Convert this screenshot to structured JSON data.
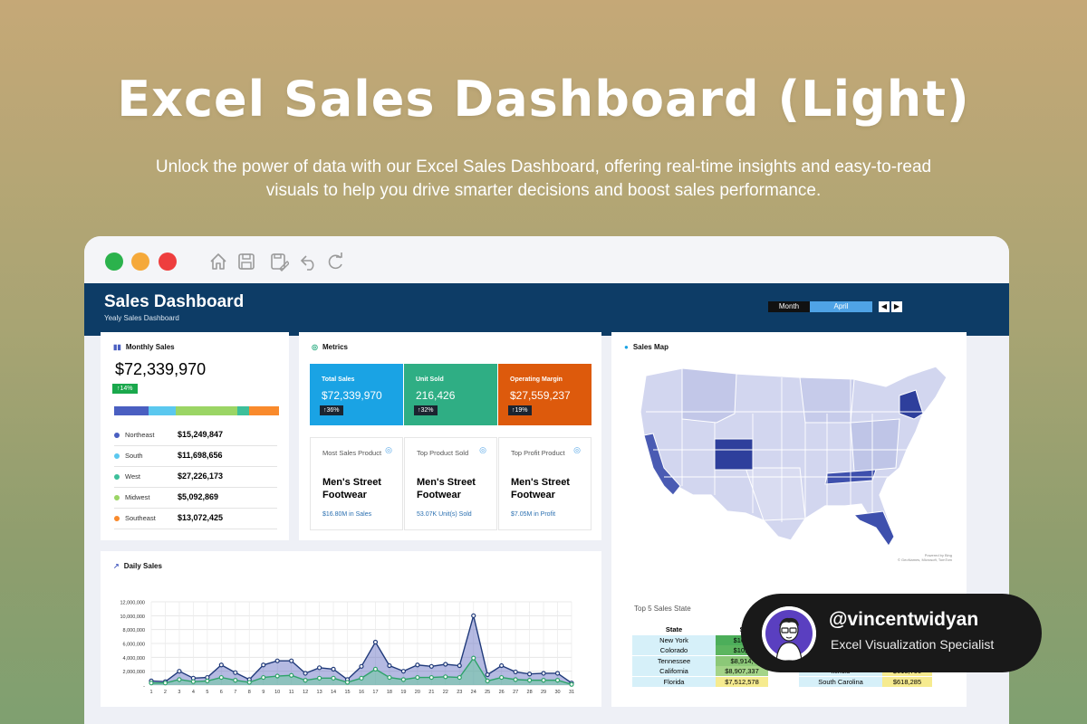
{
  "hero": {
    "title": "Excel Sales Dashboard (Light)",
    "subtitle": "Unlock the power of data with our Excel Sales Dashboard, offering real-time insights and easy-to-read visuals to help you drive smarter decisions and boost sales performance."
  },
  "window": {
    "traffic_lights": [
      {
        "name": "green",
        "color": "#2bb24c"
      },
      {
        "name": "yellow",
        "color": "#f5a93a"
      },
      {
        "name": "red",
        "color": "#ee3e3e"
      }
    ],
    "toolbar_icons": [
      "home-icon",
      "save-icon",
      "save-as-icon",
      "undo-icon",
      "redo-icon"
    ]
  },
  "header": {
    "title": "Sales Dashboard",
    "subtitle": "Yealy Sales Dashboard",
    "period_label": "Month",
    "period_value": "April",
    "prev": "◀",
    "next": "▶",
    "color": "#0d3c66"
  },
  "monthly_sales": {
    "title": "Monthly Sales",
    "total": "$72,339,970",
    "change": "↑14%",
    "regions": [
      {
        "name": "Northeast",
        "value": "$15,249,847",
        "color": "#4a5fc1",
        "share": 0.211
      },
      {
        "name": "South",
        "value": "$11,698,656",
        "color": "#5bc8ef",
        "share": 0.162
      },
      {
        "name": "West",
        "value": "$27,226,173",
        "color": "#9bd565",
        "share": 0.376
      },
      {
        "name": "Midwest",
        "value": "$5,092,869",
        "color": "#3dbf9a",
        "share": 0.07
      },
      {
        "name": "Southeast",
        "value": "$13,072,425",
        "color": "#f98a2c",
        "share": 0.181
      }
    ],
    "bullet_colors": [
      "#4a5fc1",
      "#5bc8ef",
      "#3dbf9a",
      "#9bd565",
      "#f98a2c"
    ]
  },
  "metrics": {
    "title": "Metrics",
    "kpis": [
      {
        "label": "Total Sales",
        "value": "$72,339,970",
        "change": "↑36%",
        "color": "#1aa3e4"
      },
      {
        "label": "Unit Sold",
        "value": "216,426",
        "change": "↑32%",
        "color": "#2fae84"
      },
      {
        "label": "Operating Margin",
        "value": "$27,559,237",
        "change": "↑19%",
        "color": "#dd5a0c"
      }
    ],
    "products": [
      {
        "label": "Most Sales Product",
        "name": "Men's Street Footwear",
        "foot": "$16.80M in Sales"
      },
      {
        "label": "Top Product Sold",
        "name": "Men's Street Footwear",
        "foot": "53.07K Unit(s) Sold"
      },
      {
        "label": "Top Profit Product",
        "name": "Men's Street Footwear",
        "foot": "$7.05M in Profit"
      }
    ]
  },
  "sales_map": {
    "title": "Sales Map",
    "credit_1": "Powered by Bing",
    "credit_2": "© GeoNames, Microsoft, TomTom",
    "top5_title": "Top 5 Sales State",
    "table_header": "State",
    "table_header_2": "S",
    "left_rows": [
      {
        "state": "New York",
        "value": "$10,1",
        "color": "#4cae5a"
      },
      {
        "state": "Colorado",
        "value": "$10,0",
        "color": "#5cb55f"
      },
      {
        "state": "Tennessee",
        "value": "$8,914,",
        "color": "#8cc878"
      },
      {
        "state": "California",
        "value": "$8,907,337",
        "color": "#a4d488"
      },
      {
        "state": "Florida",
        "value": "$7,512,578",
        "color": "#f6eb8f"
      }
    ],
    "right_rows": [
      {
        "state": "",
        "value": "",
        "color": "#d6f0f9"
      },
      {
        "state": "",
        "value": "",
        "color": "#d6f0f9"
      },
      {
        "state": "",
        "value": "",
        "color": "#d6f0f9"
      },
      {
        "state": "Illinois",
        "value": "$618,700",
        "color": "#f6eb8f"
      },
      {
        "state": "South Carolina",
        "value": "$618,285",
        "color": "#f6eb8f"
      }
    ]
  },
  "daily_sales": {
    "title": "Daily Sales"
  },
  "chart_data": {
    "type": "area",
    "title": "Daily Sales",
    "x": [
      1,
      2,
      3,
      4,
      5,
      6,
      7,
      8,
      9,
      10,
      11,
      12,
      13,
      14,
      15,
      16,
      17,
      18,
      19,
      20,
      21,
      22,
      23,
      24,
      25,
      26,
      27,
      28,
      29,
      30,
      31
    ],
    "y_ticks": [
      "-",
      "2,000,000",
      "4,000,000",
      "6,000,000",
      "8,000,000",
      "10,000,000",
      "12,000,000"
    ],
    "ylim": [
      0,
      12000000
    ],
    "grid": true,
    "series": [
      {
        "values": [
          600000,
          500000,
          2000000,
          1000000,
          1100000,
          2900000,
          1800000,
          800000,
          2900000,
          3500000,
          3500000,
          1700000,
          2500000,
          2300000,
          800000,
          2700000,
          6200000,
          2800000,
          2000000,
          2900000,
          2700000,
          3000000,
          2800000,
          10000000,
          1500000,
          2800000,
          1900000,
          1600000,
          1700000,
          1700000,
          300000
        ],
        "color": "#203a7a"
      },
      {
        "values": [
          300000,
          300000,
          800000,
          500000,
          600000,
          1100000,
          700000,
          400000,
          1100000,
          1300000,
          1400000,
          700000,
          1000000,
          1000000,
          400000,
          1000000,
          2300000,
          1100000,
          800000,
          1100000,
          1100000,
          1200000,
          1100000,
          3900000,
          600000,
          1100000,
          800000,
          700000,
          700000,
          700000,
          100000
        ],
        "color": "#2ea36a"
      }
    ]
  },
  "profile": {
    "handle": "@vincentwidyan",
    "role": "Excel Visualization Specialist"
  }
}
